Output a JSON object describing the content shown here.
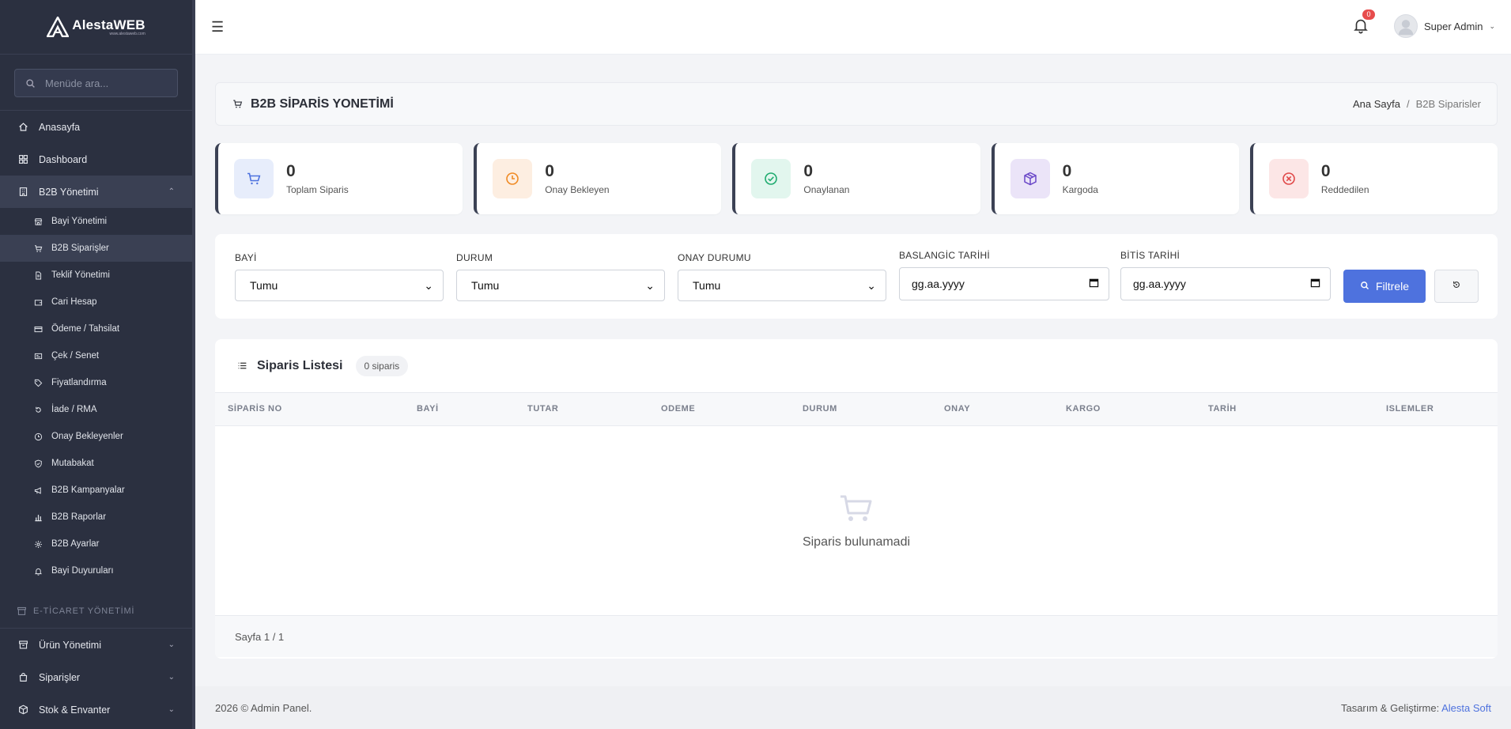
{
  "brand": {
    "name": "AlestaWEB",
    "sub": "www.alestaweb.com"
  },
  "sidebar": {
    "search_placeholder": "Menüde ara...",
    "top_items": [
      {
        "label": "Anasayfa",
        "icon": "home-icon"
      },
      {
        "label": "Dashboard",
        "icon": "grid-icon"
      }
    ],
    "group": {
      "label": "B2B Yönetimi",
      "icon": "building-icon"
    },
    "sub_items": [
      {
        "label": "Bayi Yönetimi",
        "icon": "store-icon"
      },
      {
        "label": "B2B Siparişler",
        "icon": "cart-icon"
      },
      {
        "label": "Teklif Yönetimi",
        "icon": "file-icon"
      },
      {
        "label": "Cari Hesap",
        "icon": "wallet-icon"
      },
      {
        "label": "Ödeme / Tahsilat",
        "icon": "credit-card-icon"
      },
      {
        "label": "Çek / Senet",
        "icon": "receipt-icon"
      },
      {
        "label": "Fiyatlandırma",
        "icon": "tag-icon"
      },
      {
        "label": "İade / RMA",
        "icon": "undo-icon"
      },
      {
        "label": "Onay Bekleyenler",
        "icon": "clock-icon"
      },
      {
        "label": "Mutabakat",
        "icon": "shield-check-icon"
      },
      {
        "label": "B2B Kampanyalar",
        "icon": "megaphone-icon"
      },
      {
        "label": "B2B Raporlar",
        "icon": "bar-chart-icon"
      },
      {
        "label": "B2B Ayarlar",
        "icon": "gear-icon"
      },
      {
        "label": "Bayi Duyuruları",
        "icon": "bell-icon"
      }
    ],
    "section_label": "E-TİCARET YÖNETİMİ",
    "bottom_items": [
      {
        "label": "Ürün Yönetimi",
        "icon": "box-icon"
      },
      {
        "label": "Siparişler",
        "icon": "bag-icon"
      },
      {
        "label": "Stok & Envanter",
        "icon": "cubes-icon"
      }
    ]
  },
  "topbar": {
    "notification_count": "0",
    "user_name": "Super Admin"
  },
  "page": {
    "title": "B2B SİPARİS YONETİMİ",
    "breadcrumb_home": "Ana Sayfa",
    "breadcrumb_sep": "/",
    "breadcrumb_current": "B2B Siparisler"
  },
  "stats": [
    {
      "value": "0",
      "label": "Toplam Siparis",
      "color": "#4e72de",
      "bg": "#e7edfb"
    },
    {
      "value": "0",
      "label": "Onay Bekleyen",
      "color": "#f08a24",
      "bg": "#fdeee1"
    },
    {
      "value": "0",
      "label": "Onaylanan",
      "color": "#1fab6f",
      "bg": "#e2f6ee"
    },
    {
      "value": "0",
      "label": "Kargoda",
      "color": "#6a47c8",
      "bg": "#ebe4f8"
    },
    {
      "value": "0",
      "label": "Reddedilen",
      "color": "#e04848",
      "bg": "#fce6e6"
    }
  ],
  "filters": {
    "bayi_label": "BAYİ",
    "bayi_value": "Tumu",
    "durum_label": "DURUM",
    "durum_value": "Tumu",
    "onay_label": "ONAY DURUMU",
    "onay_value": "Tumu",
    "start_label": "BASLANGİC TARİHİ",
    "start_value": "gg.aa.yyyy",
    "end_label": "BİTİS TARİHİ",
    "end_value": "gg.aa.yyyy",
    "filter_button": "Filtrele"
  },
  "list": {
    "title": "Siparis Listesi",
    "count": "0 siparis",
    "columns": [
      "SİPARİS NO",
      "BAYİ",
      "TUTAR",
      "ODEME",
      "DURUM",
      "ONAY",
      "KARGO",
      "TARİH",
      "ISLEMLER"
    ],
    "empty_text": "Siparis bulunamadi",
    "pagination": "Sayfa 1 / 1"
  },
  "footer": {
    "copyright": "2026 © Admin Panel.",
    "credit_prefix": "Tasarım & Geliştirme:",
    "credit_link": "Alesta Soft"
  }
}
